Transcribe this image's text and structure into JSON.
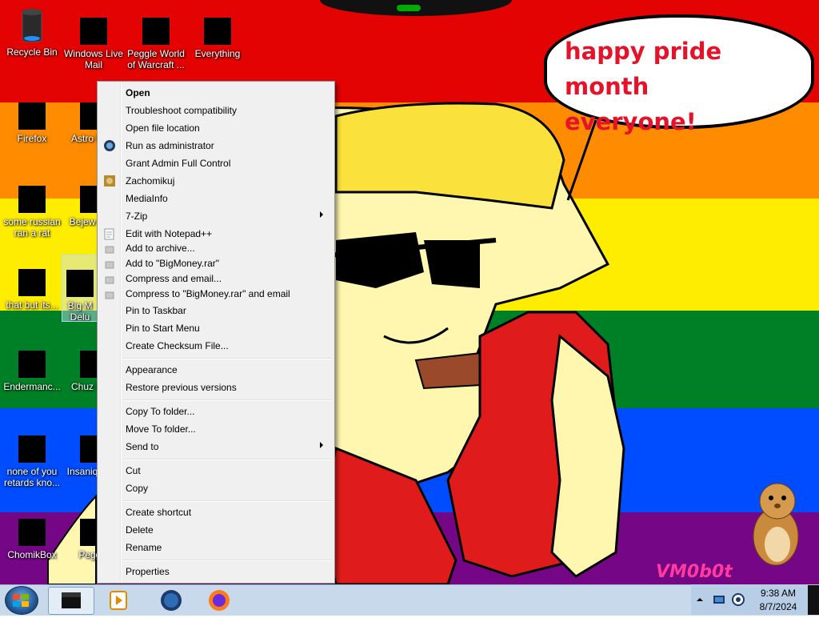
{
  "wallpaper": {
    "bubble_line1": "happy pride month",
    "bubble_line2": "everyone!",
    "watermark": "VM0b0t"
  },
  "desktop_icons": [
    {
      "label": "Recycle Bin",
      "icon": "recycle-bin-icon"
    },
    {
      "label": "Windows Live Mail",
      "icon": "windows-live-mail-icon"
    },
    {
      "label": "Peggle World of Warcraft ...",
      "icon": "peggle-icon"
    },
    {
      "label": "Everything",
      "icon": "everything-search-icon"
    },
    {
      "label": "Firefox",
      "icon": "firefox-icon"
    },
    {
      "label": "Astro Delu",
      "icon": "astro-icon"
    },
    {
      "label": "some russian ran a rat",
      "icon": "app-icon"
    },
    {
      "label": "Bejew Delu",
      "icon": "bejeweled-icon"
    },
    {
      "label": "that but its...",
      "icon": "folder-stack-icon"
    },
    {
      "label": "Big M Delu",
      "icon": "bigmoney-icon"
    },
    {
      "label": "Endermanc...",
      "icon": "app-icon"
    },
    {
      "label": "Chuz Delu",
      "icon": "chuzzle-icon"
    },
    {
      "label": "none of you retards kno...",
      "icon": "app-icon"
    },
    {
      "label": "Insaniq Delu",
      "icon": "insaniquarium-icon"
    },
    {
      "label": "ChomikBox",
      "icon": "chomikbox-icon"
    },
    {
      "label": "Peggle",
      "icon": "peggle-icon"
    }
  ],
  "context_menu": {
    "open": "Open",
    "troubleshoot": "Troubleshoot compatibility",
    "open_location": "Open file location",
    "run_admin": "Run as administrator",
    "grant_admin": "Grant Admin Full Control",
    "zachomikuj": "Zachomikuj",
    "mediainfo": "MediaInfo",
    "sevenzip": "7-Zip",
    "notepad": "Edit with Notepad++",
    "add_archive": "Add to archive...",
    "add_rar": "Add to \"BigMoney.rar\"",
    "compress_email": "Compress and email...",
    "compress_rar_email": "Compress to \"BigMoney.rar\" and email",
    "pin_taskbar": "Pin to Taskbar",
    "pin_start": "Pin to Start Menu",
    "checksum": "Create Checksum File...",
    "appearance": "Appearance",
    "restore": "Restore previous versions",
    "copy_to": "Copy To folder...",
    "move_to": "Move To folder...",
    "send_to": "Send to",
    "cut": "Cut",
    "copy": "Copy",
    "create_shortcut": "Create shortcut",
    "delete": "Delete",
    "rename": "Rename",
    "properties": "Properties"
  },
  "taskbar": {
    "time": "9:38 AM",
    "date": "8/7/2024"
  }
}
